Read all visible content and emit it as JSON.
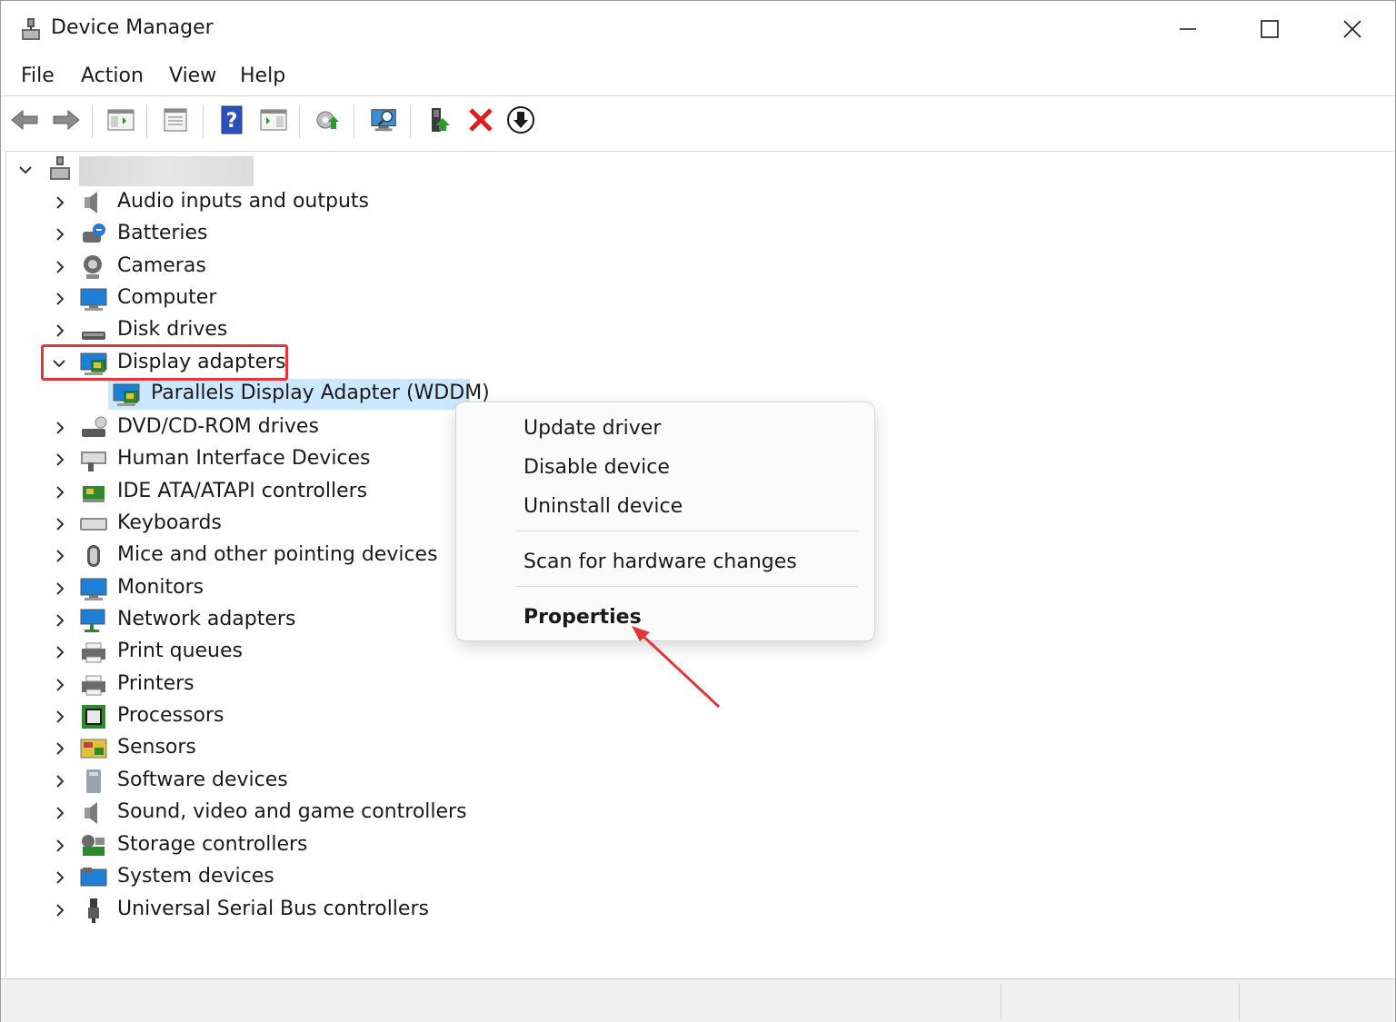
{
  "window": {
    "title": "Device Manager"
  },
  "menu": [
    "File",
    "Action",
    "View",
    "Help"
  ],
  "toolbar": {
    "buttons": [
      "back-icon",
      "forward-icon",
      "show-hide-console-tree-icon",
      "properties-icon",
      "help-icon",
      "action-pane-icon",
      "update-driver-icon",
      "scan-hardware-icon",
      "enable-device-icon",
      "uninstall-device-icon",
      "disable-device-icon"
    ]
  },
  "tree": {
    "root_name": "",
    "categories": [
      {
        "label": "Audio inputs and outputs",
        "icon": "speaker-icon"
      },
      {
        "label": "Batteries",
        "icon": "battery-icon"
      },
      {
        "label": "Cameras",
        "icon": "camera-icon"
      },
      {
        "label": "Computer",
        "icon": "computer-icon"
      },
      {
        "label": "Disk drives",
        "icon": "disk-drive-icon"
      },
      {
        "label": "Display adapters",
        "icon": "display-adapter-icon",
        "expanded": true
      },
      {
        "label": "DVD/CD-ROM drives",
        "icon": "dvd-drive-icon"
      },
      {
        "label": "Human Interface Devices",
        "icon": "hid-icon"
      },
      {
        "label": "IDE ATA/ATAPI controllers",
        "icon": "ide-controller-icon"
      },
      {
        "label": "Keyboards",
        "icon": "keyboard-icon"
      },
      {
        "label": "Mice and other pointing devices",
        "icon": "mouse-icon"
      },
      {
        "label": "Monitors",
        "icon": "monitor-icon"
      },
      {
        "label": "Network adapters",
        "icon": "network-adapter-icon"
      },
      {
        "label": "Print queues",
        "icon": "print-queue-icon"
      },
      {
        "label": "Printers",
        "icon": "printer-icon"
      },
      {
        "label": "Processors",
        "icon": "processor-icon"
      },
      {
        "label": "Sensors",
        "icon": "sensor-icon"
      },
      {
        "label": "Software devices",
        "icon": "software-device-icon"
      },
      {
        "label": "Sound, video and game controllers",
        "icon": "sound-controller-icon"
      },
      {
        "label": "Storage controllers",
        "icon": "storage-controller-icon"
      },
      {
        "label": "System devices",
        "icon": "system-device-icon"
      },
      {
        "label": "Universal Serial Bus controllers",
        "icon": "usb-icon"
      }
    ],
    "display_child": {
      "label": "Parallels Display Adapter (WDDM)",
      "icon": "display-adapter-icon"
    }
  },
  "context_menu": {
    "items": [
      "Update driver",
      "Disable device",
      "Uninstall device",
      "Scan for hardware changes",
      "Properties"
    ]
  },
  "colors": {
    "highlight_box": "#e3353a",
    "selection": "#cce8ff",
    "annotation_arrow": "#e3353a"
  }
}
